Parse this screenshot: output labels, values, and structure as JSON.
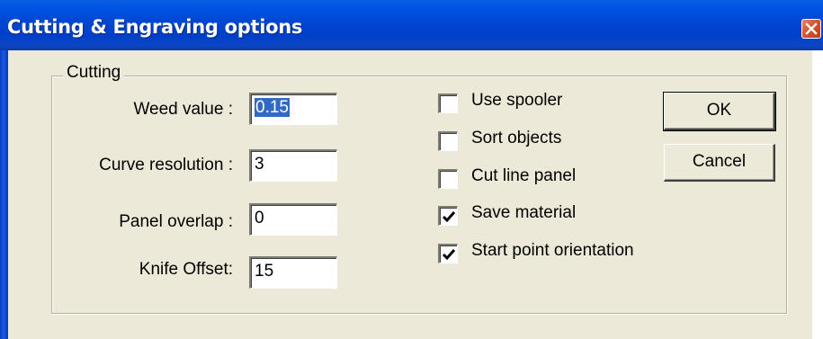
{
  "window": {
    "title": "Cutting & Engraving options",
    "close_icon": "close-x-icon"
  },
  "cutting_group": {
    "legend": "Cutting",
    "fields": [
      {
        "label": "Weed value :",
        "value": "0.15",
        "selected": true
      },
      {
        "label": "Curve resolution :",
        "value": "3",
        "selected": false
      },
      {
        "label": "Panel overlap :",
        "value": "0",
        "selected": false
      },
      {
        "label": "Knife Offset:",
        "value": "15",
        "selected": false
      }
    ],
    "checkboxes": [
      {
        "label": "Use spooler",
        "checked": false
      },
      {
        "label": "Sort objects",
        "checked": false
      },
      {
        "label": "Cut line panel",
        "checked": false
      },
      {
        "label": "Save material",
        "checked": true
      },
      {
        "label": "Start point orientation",
        "checked": true
      }
    ]
  },
  "buttons": {
    "ok": "OK",
    "cancel": "Cancel"
  },
  "colors": {
    "titlebar": "#0048d4",
    "dialog_bg": "#ece9d8",
    "close_button": "#d9542f",
    "selection": "#316ac5"
  }
}
